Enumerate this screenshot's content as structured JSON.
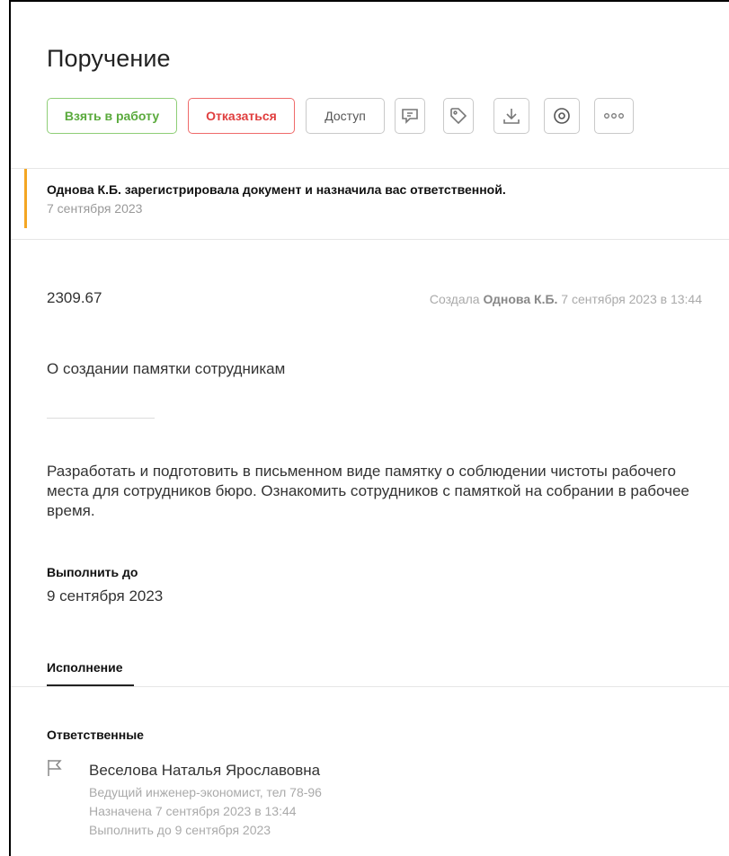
{
  "page": {
    "title": "Поручение"
  },
  "toolbar": {
    "take_label": "Взять в работу",
    "reject_label": "Отказаться",
    "access_label": "Доступ",
    "icons": [
      "comment-icon",
      "tag-icon",
      "download-icon",
      "eye-icon",
      "more-icon"
    ]
  },
  "notice": {
    "text": "Однова К.Б. зарегистрировала документ и назначила вас ответственной.",
    "date": "7 сентября 2023"
  },
  "document": {
    "number": "2309.67",
    "created_prefix": "Создала",
    "created_by": "Однова К.Б.",
    "created_at": "7 сентября 2023 в 13:44",
    "subject": "О создании памятки сотрудникам",
    "description": "Разработать и подготовить в письменном виде памятку о соблюдении чистоты рабочего места для сотрудников бюро. Ознакомить сотрудников с памяткой на собрании в рабочее время.",
    "due_label": "Выполнить до",
    "due_value": "9 сентября 2023"
  },
  "tabs": {
    "execution": "Исполнение"
  },
  "responsible": {
    "label": "Ответственные",
    "name": "Веселова Наталья Ярославовна",
    "position": "Ведущий инженер-экономист, тел 78-96",
    "assigned": "Назначена 7 сентября 2023 в 13:44",
    "due": "Выполнить до 9 сентября 2023"
  },
  "colors": {
    "accent_green": "#5aaa3c",
    "accent_red": "#e03e3e",
    "notice_orange": "#f4a623"
  }
}
